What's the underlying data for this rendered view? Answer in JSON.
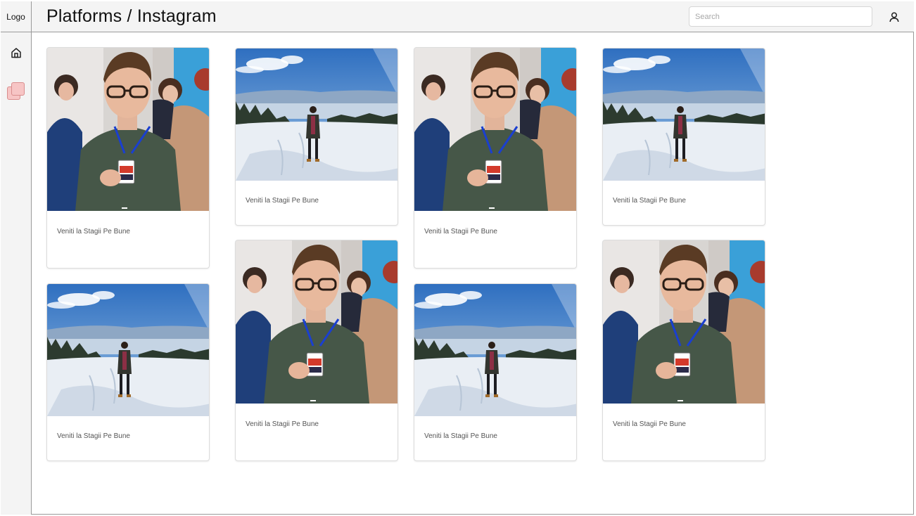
{
  "logo": "Logo",
  "header": {
    "title": "Platforms / Instagram"
  },
  "search": {
    "placeholder": "Search",
    "value": ""
  },
  "sidebar": {
    "items": [
      {
        "icon": "home-icon"
      },
      {
        "icon": "platforms-icon"
      }
    ]
  },
  "posts": [
    {
      "caption": "Veniti la Stagii Pe Bune",
      "image": "conference-portrait"
    },
    {
      "caption": "Veniti la Stagii Pe Bune",
      "image": "snowy-mountain"
    },
    {
      "caption": "Veniti la Stagii Pe Bune",
      "image": "conference-portrait"
    },
    {
      "caption": "Veniti la Stagii Pe Bune",
      "image": "snowy-mountain"
    },
    {
      "caption": "Veniti la Stagii Pe Bune",
      "image": "snowy-mountain"
    },
    {
      "caption": "Veniti la Stagii Pe Bune",
      "image": "conference-portrait"
    },
    {
      "caption": "Veniti la Stagii Pe Bune",
      "image": "snowy-mountain"
    },
    {
      "caption": "Veniti la Stagii Pe Bune",
      "image": "conference-portrait"
    }
  ],
  "colors": {
    "chrome_bg": "#f4f4f4",
    "border": "#9a9a9a",
    "accent_icon": "#f7c5c5"
  }
}
